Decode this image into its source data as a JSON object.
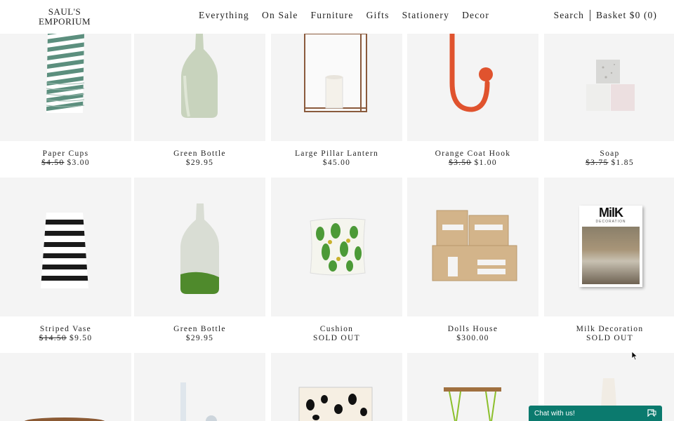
{
  "logo": {
    "line1": "SAUL'S",
    "line2": "EMPORIUM"
  },
  "nav": {
    "items": [
      {
        "label": "Everything"
      },
      {
        "label": "On Sale"
      },
      {
        "label": "Furniture"
      },
      {
        "label": "Gifts"
      },
      {
        "label": "Stationery"
      },
      {
        "label": "Decor"
      }
    ]
  },
  "utility": {
    "search": "Search",
    "basket": "Basket $0 (0)"
  },
  "products": [
    {
      "name": "Paper Cups",
      "old_price": "$4.50",
      "price": "$3.00",
      "icon": "striped-cups-image"
    },
    {
      "name": "Green Bottle",
      "old_price": "",
      "price": "$29.95",
      "icon": "green-bottle-image"
    },
    {
      "name": "Large Pillar Lantern",
      "old_price": "",
      "price": "$45.00",
      "icon": "lantern-image"
    },
    {
      "name": "Orange Coat Hook",
      "old_price": "$3.50",
      "price": "$1.00",
      "icon": "coat-hook-image"
    },
    {
      "name": "Soap",
      "old_price": "$3.75",
      "price": "$1.85",
      "icon": "soap-image"
    },
    {
      "name": "Striped Vase",
      "old_price": "$14.50",
      "price": "$9.50",
      "icon": "striped-vase-image"
    },
    {
      "name": "Green Bottle",
      "old_price": "",
      "price": "$29.95",
      "icon": "green-dipped-bottle-image"
    },
    {
      "name": "Cushion",
      "old_price": "",
      "price": "SOLD OUT",
      "icon": "cactus-cushion-image"
    },
    {
      "name": "Dolls House",
      "old_price": "",
      "price": "$300.00",
      "icon": "dolls-house-image"
    },
    {
      "name": "Milk Decoration",
      "old_price": "",
      "price": "SOLD OUT",
      "icon": "magazine-image",
      "magazine_title": "MilK",
      "magazine_sub": "DECORATION"
    }
  ],
  "chat": {
    "label": "Chat with us!"
  },
  "colors": {
    "chat": "#0b7a6e",
    "tile_bg": "#f4f4f4",
    "text": "#222222"
  }
}
